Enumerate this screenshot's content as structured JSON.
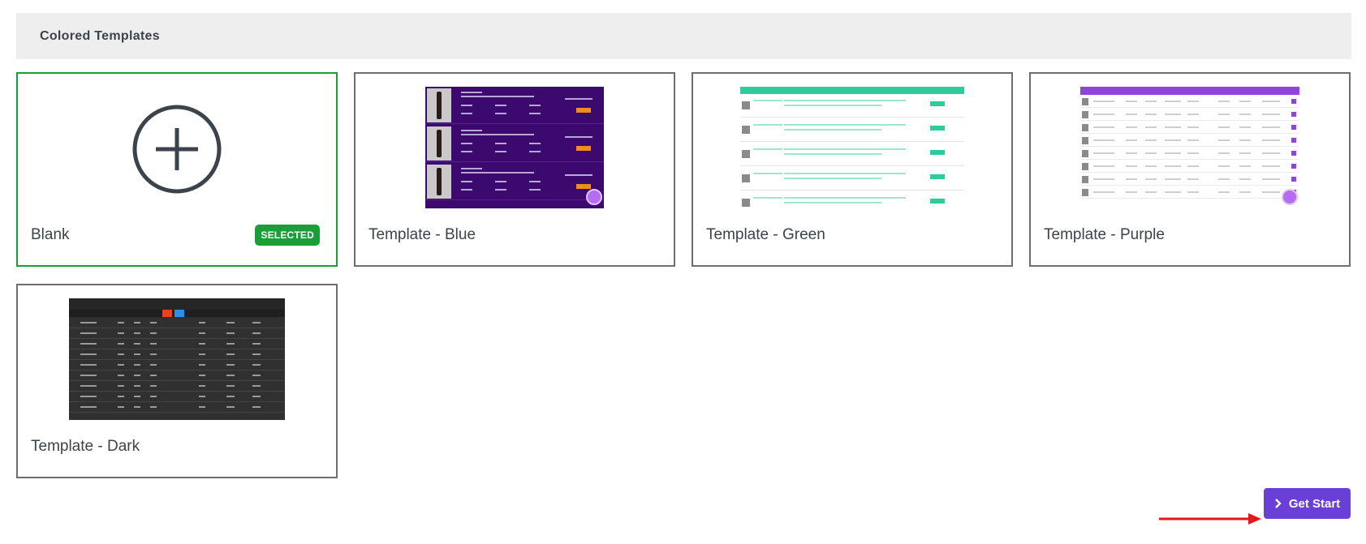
{
  "section": {
    "title": "Colored Templates"
  },
  "templates": [
    {
      "label": "Blank",
      "selected": true,
      "badge": "SELECTED",
      "icon": "plus-circle-icon"
    },
    {
      "label": "Template - Blue",
      "selected": false,
      "accent": "#3c0a6e"
    },
    {
      "label": "Template - Green",
      "selected": false,
      "accent": "#2ecc9a"
    },
    {
      "label": "Template - Purple",
      "selected": false,
      "accent": "#8e44d8"
    },
    {
      "label": "Template - Dark",
      "selected": false,
      "accent": "#303030"
    }
  ],
  "actions": {
    "get_start_label": "Get Start",
    "get_start_icon": "chevron-right-icon"
  },
  "colors": {
    "selected_border": "#1a9e3a",
    "badge_bg": "#1a9e3a",
    "primary_button": "#6a3fd8",
    "pointer_arrow": "#e8141c"
  }
}
